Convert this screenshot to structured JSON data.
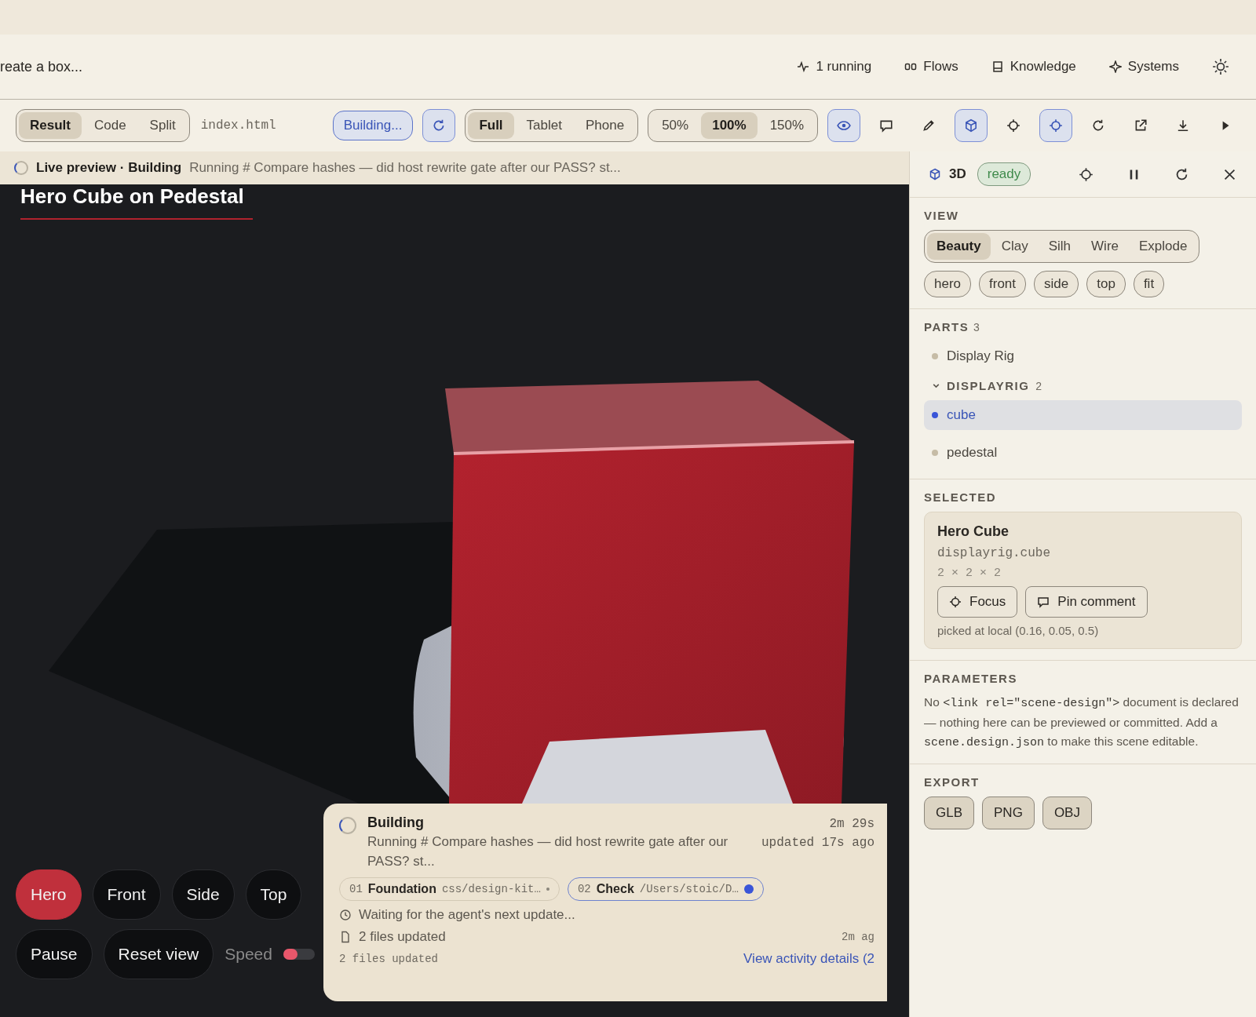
{
  "header": {
    "prompt": "reate a box...",
    "nav": [
      {
        "label": "1 running"
      },
      {
        "label": "Flows"
      },
      {
        "label": "Knowledge"
      },
      {
        "label": "Systems"
      }
    ]
  },
  "toolbar": {
    "modes": [
      {
        "label": "Result",
        "selected": true
      },
      {
        "label": "Code",
        "selected": false
      },
      {
        "label": "Split",
        "selected": false
      }
    ],
    "file": "index.html",
    "status": "Building...",
    "devices": [
      {
        "label": "Full",
        "selected": true
      },
      {
        "label": "Tablet",
        "selected": false
      },
      {
        "label": "Phone",
        "selected": false
      }
    ],
    "zooms": [
      {
        "label": "50%",
        "selected": false
      },
      {
        "label": "100%",
        "selected": true
      },
      {
        "label": "150%",
        "selected": false
      }
    ],
    "icon_buttons": [
      {
        "active": true
      },
      {
        "active": false
      },
      {
        "active": false
      },
      {
        "active": true
      },
      {
        "active": false
      },
      {
        "active": true
      },
      {
        "active": false
      },
      {
        "active": false
      },
      {
        "active": false
      },
      {
        "active": false
      }
    ]
  },
  "banner": {
    "title": "Live preview · Building",
    "message": "Running # Compare hashes — did host rewrite gate after our PASS? st..."
  },
  "viewport": {
    "heading": "Hero Cube on Pedestal",
    "cameras": [
      {
        "label": "Hero",
        "selected": true
      },
      {
        "label": "Front",
        "selected": false
      },
      {
        "label": "Side",
        "selected": false
      },
      {
        "label": "Top",
        "selected": false
      }
    ],
    "actions": [
      "Pause",
      "Reset view"
    ],
    "speed": {
      "label": "Speed",
      "level": 0.45
    }
  },
  "activity": {
    "title": "Building",
    "description": "Running # Compare hashes — did host rewrite gate after our PASS? st...",
    "elapsed": "2m 29s",
    "updated": "updated 17s ago",
    "steps": [
      {
        "number": "01",
        "name": "Foundation",
        "path": "css/design-kit…",
        "active": false
      },
      {
        "number": "02",
        "name": "Check",
        "path": "/Users/stoic/D…",
        "active": true
      }
    ],
    "waiting": "Waiting for the agent's next update...",
    "files": "2 files updated",
    "files_time": "2m ag",
    "summary": "2 files updated",
    "link": "View activity details (2"
  },
  "panel": {
    "title": "3D",
    "status": "ready",
    "view_label": "VIEW",
    "views": [
      {
        "label": "Beauty",
        "selected": true
      },
      {
        "label": "Clay",
        "selected": false
      },
      {
        "label": "Silh",
        "selected": false
      },
      {
        "label": "Wire",
        "selected": false
      },
      {
        "label": "Explode",
        "selected": false
      }
    ],
    "cameras": [
      "hero",
      "front",
      "side",
      "top",
      "fit"
    ],
    "parts_label": "PARTS",
    "parts_count": "3",
    "parts": [
      {
        "name": "Display Rig",
        "kind": "item",
        "selected": false
      },
      {
        "name": "DISPLAYRIG",
        "kind": "group",
        "count": "2",
        "expanded": true,
        "children": [
          {
            "name": "cube",
            "kind": "item",
            "selected": true
          },
          {
            "name": "pedestal",
            "kind": "item",
            "selected": false
          }
        ]
      }
    ],
    "selected_label": "SELECTED",
    "selected": {
      "name": "Hero Cube",
      "path": "displayrig.cube",
      "size": "2 × 2 × 2",
      "buttons": [
        "Focus",
        "Pin comment"
      ],
      "picked": "picked at local (0.16, 0.05, 0.5)"
    },
    "parameters_label": "PARAMETERS",
    "parameters": [
      {
        "text": "No ",
        "code": false
      },
      {
        "text": "<link rel=\"scene-design\">",
        "code": true
      },
      {
        "text": " document is declared — nothing here can be previewed or committed. Add a ",
        "code": false
      },
      {
        "text": "scene.design.json",
        "code": true
      },
      {
        "text": " to make this scene editable.",
        "code": false
      }
    ],
    "export_label": "EXPORT",
    "exports": [
      "GLB",
      "PNG",
      "OBJ"
    ]
  }
}
